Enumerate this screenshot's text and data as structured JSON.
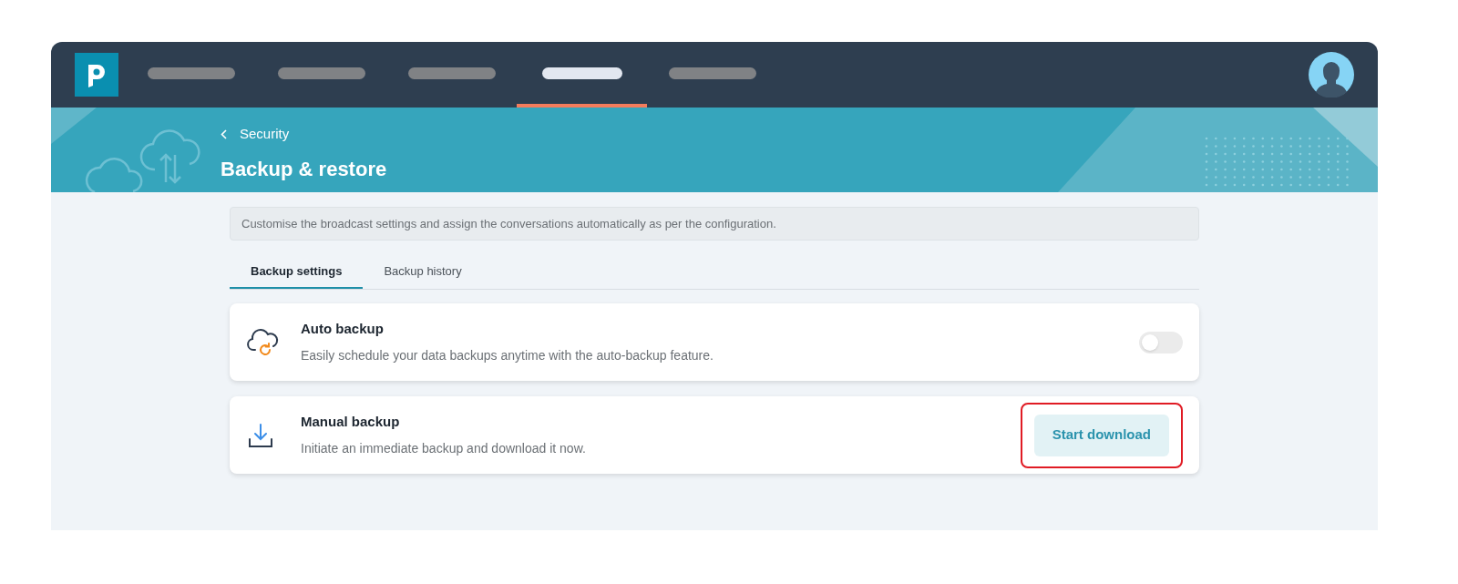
{
  "nav_items": [
    {
      "selected": false
    },
    {
      "selected": false
    },
    {
      "selected": false
    },
    {
      "selected": true
    },
    {
      "selected": false
    }
  ],
  "banner": {
    "back_label": "Security",
    "title": "Backup & restore"
  },
  "description": "Customise the broadcast settings and assign the conversations automatically as per the configuration.",
  "tabs": [
    {
      "label": "Backup settings",
      "selected": true
    },
    {
      "label": "Backup history",
      "selected": false
    }
  ],
  "cards": [
    {
      "kind": "toggle",
      "title": "Auto backup",
      "subtitle": "Easily schedule your data backups anytime with the auto-backup feature.",
      "on": false
    },
    {
      "kind": "button",
      "title": "Manual backup",
      "subtitle": "Initiate an immediate backup and download it now.",
      "button": "Start download",
      "highlighted": true
    }
  ]
}
